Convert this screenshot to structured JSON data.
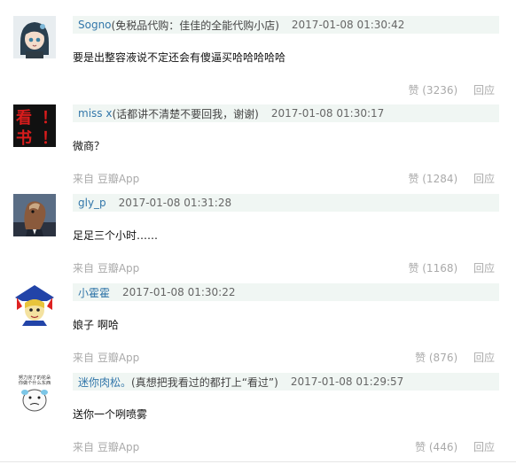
{
  "comments": [
    {
      "author": "Sogno",
      "signature": "(免税品代购：佳佳的全能代购小店)",
      "time": "2017-01-08 01:30:42",
      "text": "要是出整容液说不定还会有傻逼买哈哈哈哈哈",
      "source": "",
      "like_label": "赞 (3236)",
      "reply_label": "回应",
      "avatar_icon": "anime-girl-avatar-icon"
    },
    {
      "author": "miss x",
      "signature": "(话都讲不清楚不要回我，谢谢)",
      "time": "2017-01-08 01:30:17",
      "text": "微商？",
      "source": "来自 豆瓣App",
      "like_label": "赞 (1284)",
      "reply_label": "回应",
      "avatar_icon": "red-calligraphy-avatar-icon",
      "avatar_glyphs": [
        "看",
        "！",
        "书",
        "！"
      ]
    },
    {
      "author": "gly_p",
      "signature": "",
      "time": "2017-01-08 01:31:28",
      "text": "足足三个小时……",
      "source": "来自 豆瓣App",
      "like_label": "赞 (1168)",
      "reply_label": "回应",
      "avatar_icon": "horse-avatar-icon"
    },
    {
      "author": "小霍霍",
      "signature": "",
      "time": "2017-01-08 01:30:22",
      "text": "娘子 啊哈",
      "source": "来自 豆瓣App",
      "like_label": "赞 (876)",
      "reply_label": "回应",
      "avatar_icon": "cartoon-witch-avatar-icon"
    },
    {
      "author": "迷你肉松。",
      "signature": "(真想把我看过的都打上“看过”)",
      "time": "2017-01-08 01:29:57",
      "text": "送你一个咧喷雾",
      "source": "来自 豆瓣App",
      "like_label": "赞 (446)",
      "reply_label": "回应",
      "avatar_icon": "meme-face-avatar-icon",
      "avatar_caption": [
        "努力完了的花朵",
        "你做个什么东西"
      ]
    }
  ]
}
